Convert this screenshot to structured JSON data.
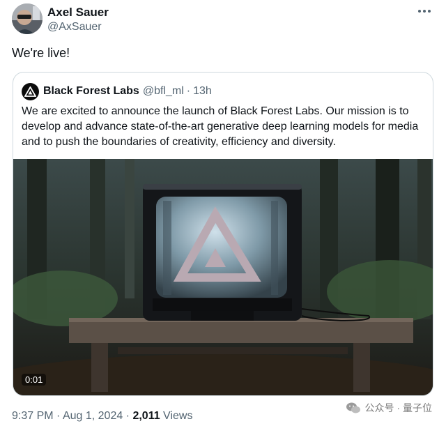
{
  "author": {
    "name": "Axel Sauer",
    "handle": "@AxSauer"
  },
  "tweet": {
    "text": "We're live!"
  },
  "quote": {
    "name": "Black Forest Labs",
    "handle": "@bfl_ml",
    "separator": "·",
    "time": "13h",
    "text": "We are excited to announce the launch of Black Forest Labs. Our mission is to develop and advance state-of-the-art generative deep learning models for media and to push the boundaries of creativity, efficiency and diversity.",
    "video_timestamp": "0:01"
  },
  "footer": {
    "time": "9:37 PM",
    "sep1": " · ",
    "date": "Aug 1, 2024",
    "sep2": " · ",
    "views_count": "2,011",
    "views_label": " Views"
  },
  "watermark": {
    "text": "公众号 · 量子位",
    "icon": "wechat-icon"
  },
  "icons": {
    "more": "more-horizontal-icon",
    "bfl_logo": "bfl-logo-icon"
  },
  "colors": {
    "secondary_text": "#536471",
    "primary_text": "#0f1419",
    "border": "#cfd9de"
  }
}
